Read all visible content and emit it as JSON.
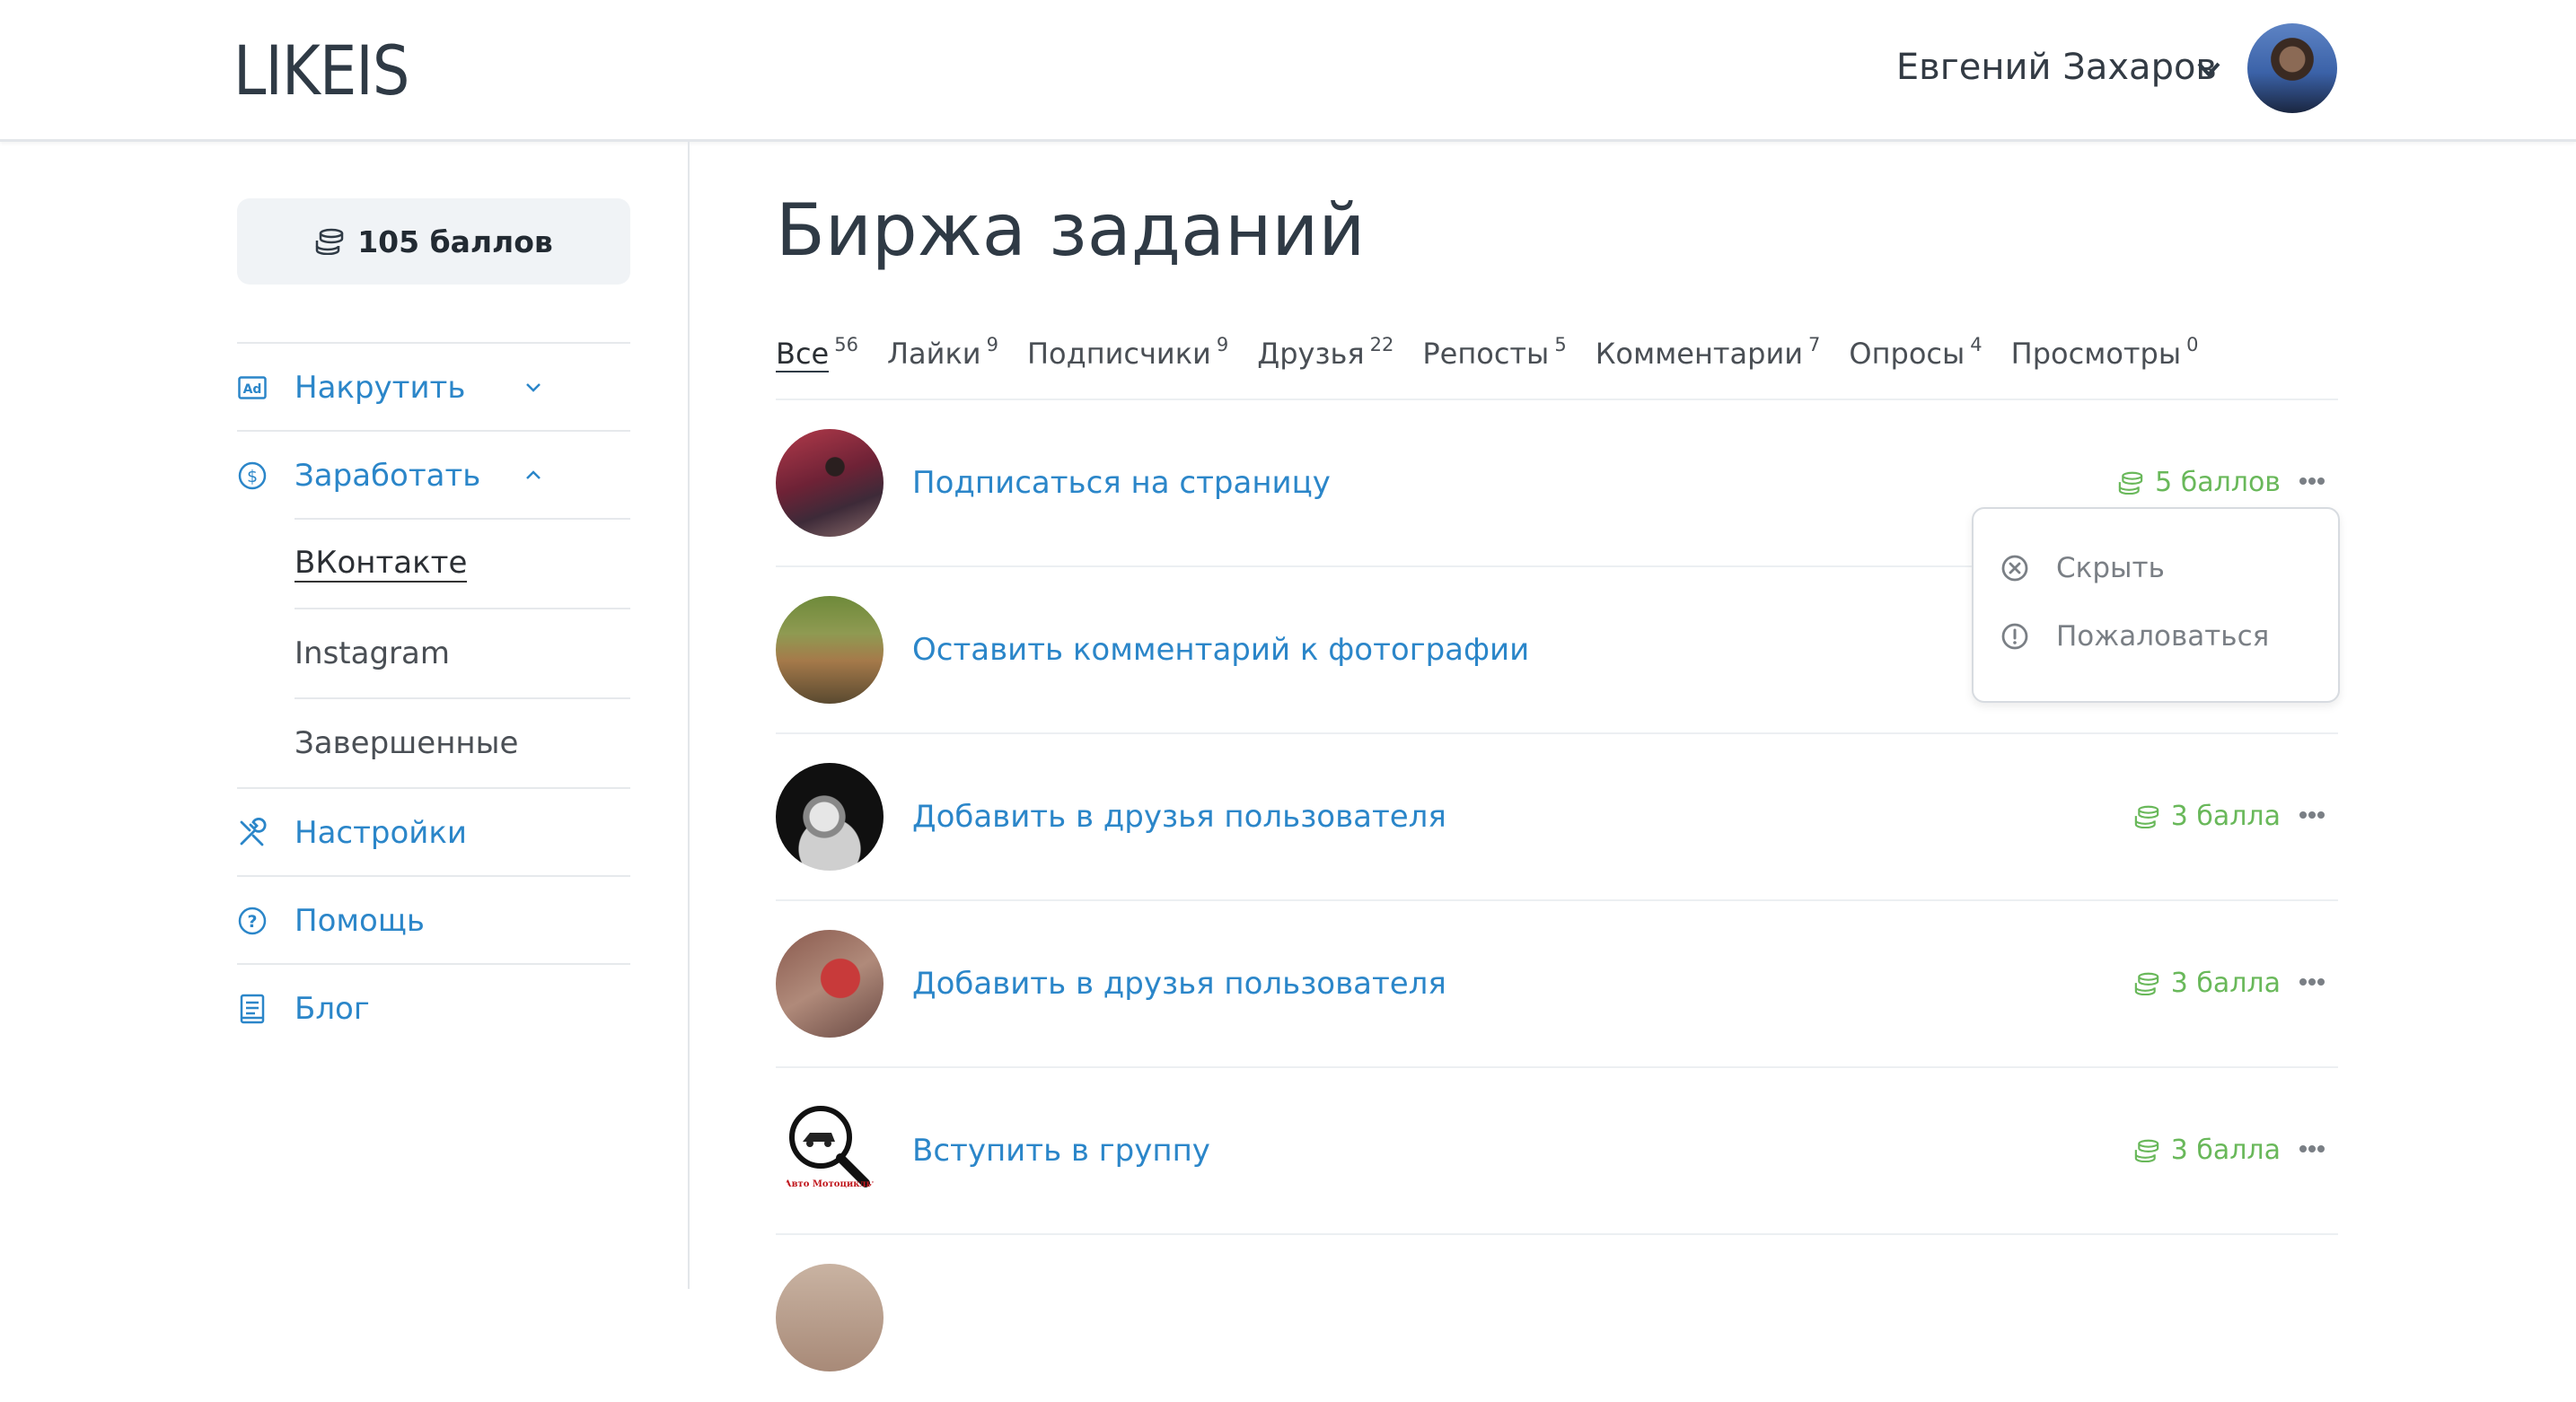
{
  "header": {
    "logo": "LIKEIS",
    "user_name": "Евгений Захаров"
  },
  "sidebar": {
    "balance": "105 баллов",
    "items": [
      {
        "label": "Накрутить",
        "icon": "ad-icon"
      },
      {
        "label": "Заработать",
        "icon": "dollar-icon"
      },
      {
        "label": "Настройки",
        "icon": "tools-icon"
      },
      {
        "label": "Помощь",
        "icon": "help-icon"
      },
      {
        "label": "Блог",
        "icon": "book-icon"
      }
    ],
    "sub_items": [
      {
        "label": "ВКонтакте"
      },
      {
        "label": "Instagram"
      },
      {
        "label": "Завершенные"
      }
    ]
  },
  "main": {
    "title": "Биржа заданий",
    "tabs": [
      {
        "label": "Все",
        "count": "56"
      },
      {
        "label": "Лайки",
        "count": "9"
      },
      {
        "label": "Подписчики",
        "count": "9"
      },
      {
        "label": "Друзья",
        "count": "22"
      },
      {
        "label": "Репосты",
        "count": "5"
      },
      {
        "label": "Комментарии",
        "count": "7"
      },
      {
        "label": "Опросы",
        "count": "4"
      },
      {
        "label": "Просмотры",
        "count": "0"
      }
    ],
    "tasks": [
      {
        "title": "Подписаться на страницу",
        "points": "5 баллов"
      },
      {
        "title": "Оставить комментарий к фотографии",
        "points": ""
      },
      {
        "title": "Добавить в друзья пользователя",
        "points": "3 балла"
      },
      {
        "title": "Добавить в друзья пользователя",
        "points": "3 балла"
      },
      {
        "title": "Вступить в группу",
        "points": "3 балла",
        "thumb_text": "Авто Мотоциклы"
      }
    ],
    "popup": {
      "hide": "Скрыть",
      "report": "Пожаловаться"
    }
  },
  "colors": {
    "link": "#2b86c9",
    "points": "#69b85a",
    "text": "#333b44"
  }
}
